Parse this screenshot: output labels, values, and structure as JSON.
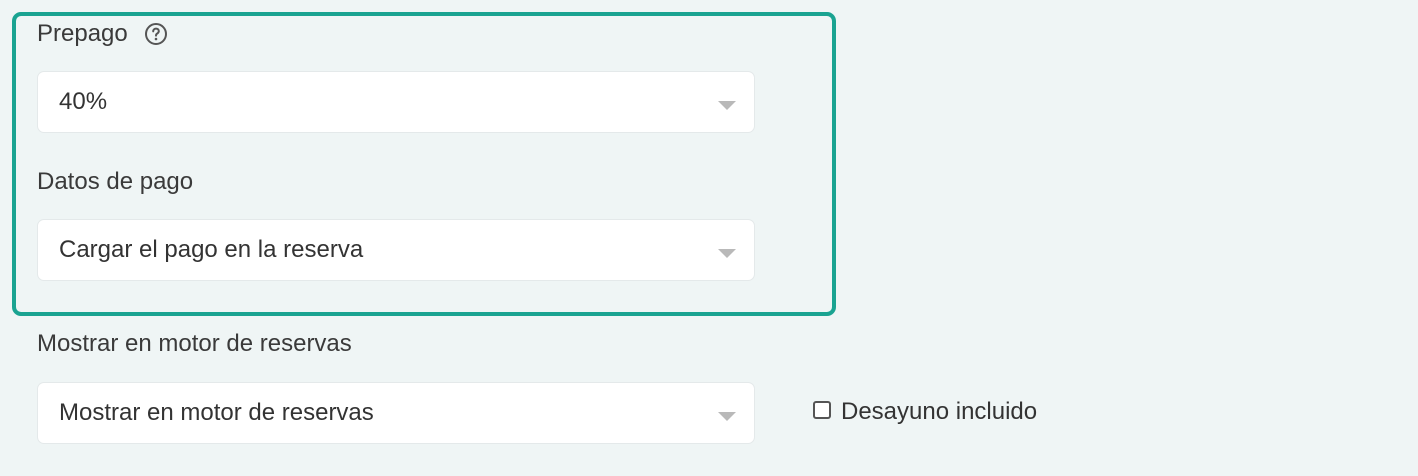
{
  "prepago": {
    "label": "Prepago",
    "selected_value": "40%",
    "help_icon": "question-circle-icon"
  },
  "datos_pago": {
    "label": "Datos de pago",
    "selected_value": "Cargar el pago en la reserva"
  },
  "motor_reservas": {
    "label": "Mostrar en motor de reservas",
    "selected_value": "Mostrar en motor de reservas"
  },
  "desayuno": {
    "label": "Desayuno incluido",
    "checked": false
  },
  "colors": {
    "background": "#eff5f5",
    "highlight_border": "#1aa391",
    "field_background": "#ffffff",
    "caret": "#b9b9b9"
  }
}
